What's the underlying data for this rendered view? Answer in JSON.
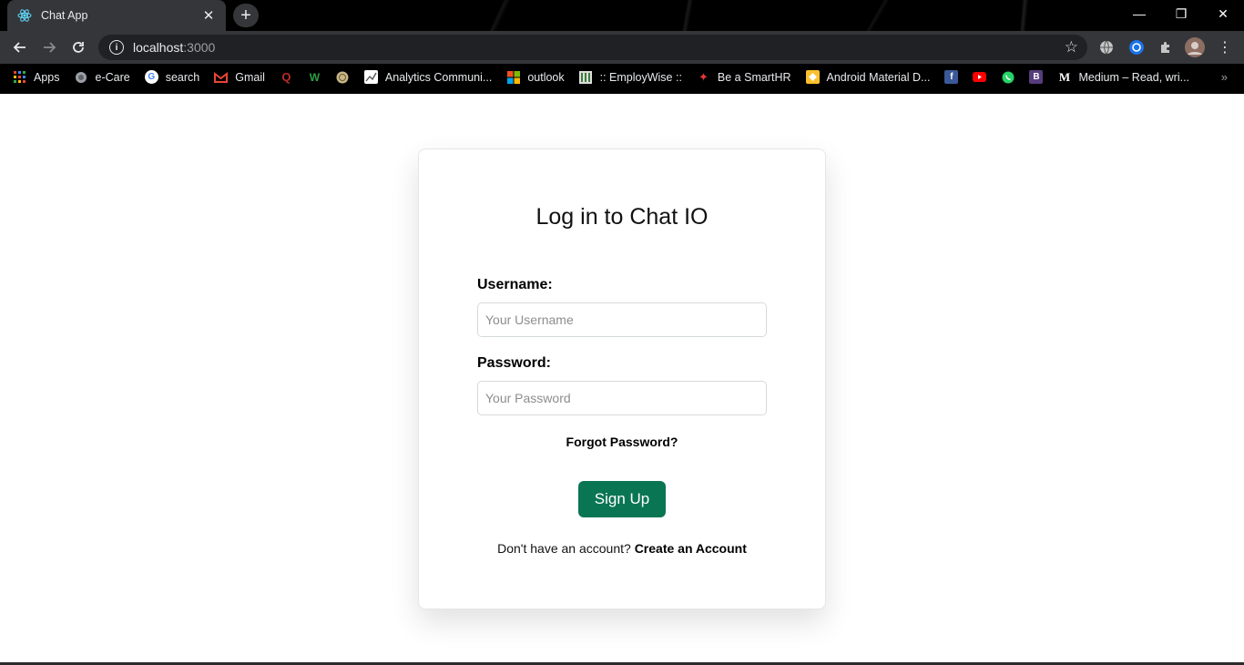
{
  "browser": {
    "tab_title": "Chat App",
    "new_tab_symbol": "+",
    "tab_close_symbol": "✕",
    "window_controls": {
      "minimize": "—",
      "restore": "❐",
      "close": "✕"
    },
    "address": {
      "host": "localhost",
      "port": ":3000"
    },
    "bookmarks": [
      {
        "label": "Apps",
        "icon": "apps-grid-icon"
      },
      {
        "label": "e-Care",
        "icon": "globe-icon"
      },
      {
        "label": "search",
        "icon": "google-icon"
      },
      {
        "label": "Gmail",
        "icon": "gmail-icon"
      },
      {
        "label": "",
        "icon": "quora-icon"
      },
      {
        "label": "",
        "icon": "w-icon"
      },
      {
        "label": "",
        "icon": "seal-icon"
      },
      {
        "label": "Analytics Communi...",
        "icon": "analytics-icon"
      },
      {
        "label": "outlook",
        "icon": "microsoft-icon"
      },
      {
        "label": ":: EmployWise ::",
        "icon": "employwise-icon"
      },
      {
        "label": "Be a SmartHR",
        "icon": "smarthr-icon"
      },
      {
        "label": "Android Material D...",
        "icon": "android-material-icon"
      },
      {
        "label": "",
        "icon": "facebook-icon"
      },
      {
        "label": "",
        "icon": "youtube-icon"
      },
      {
        "label": "",
        "icon": "whatsapp-icon"
      },
      {
        "label": "",
        "icon": "bootstrap-icon"
      },
      {
        "label": "Medium – Read, wri...",
        "icon": "medium-icon"
      }
    ],
    "bookmarks_more": "»"
  },
  "login": {
    "title": "Log in to Chat IO",
    "username_label": "Username:",
    "username_placeholder": "Your Username",
    "username_value": "",
    "password_label": "Password:",
    "password_placeholder": "Your Password",
    "password_value": "",
    "forgot_link": "Forgot Password?",
    "submit_button": "Sign Up",
    "no_account_text": "Don't have an account?",
    "create_account_link": "Create an Account"
  },
  "colors": {
    "primary_button": "#0a7553",
    "chrome_dark": "#35363a",
    "omnibox": "#202124"
  }
}
